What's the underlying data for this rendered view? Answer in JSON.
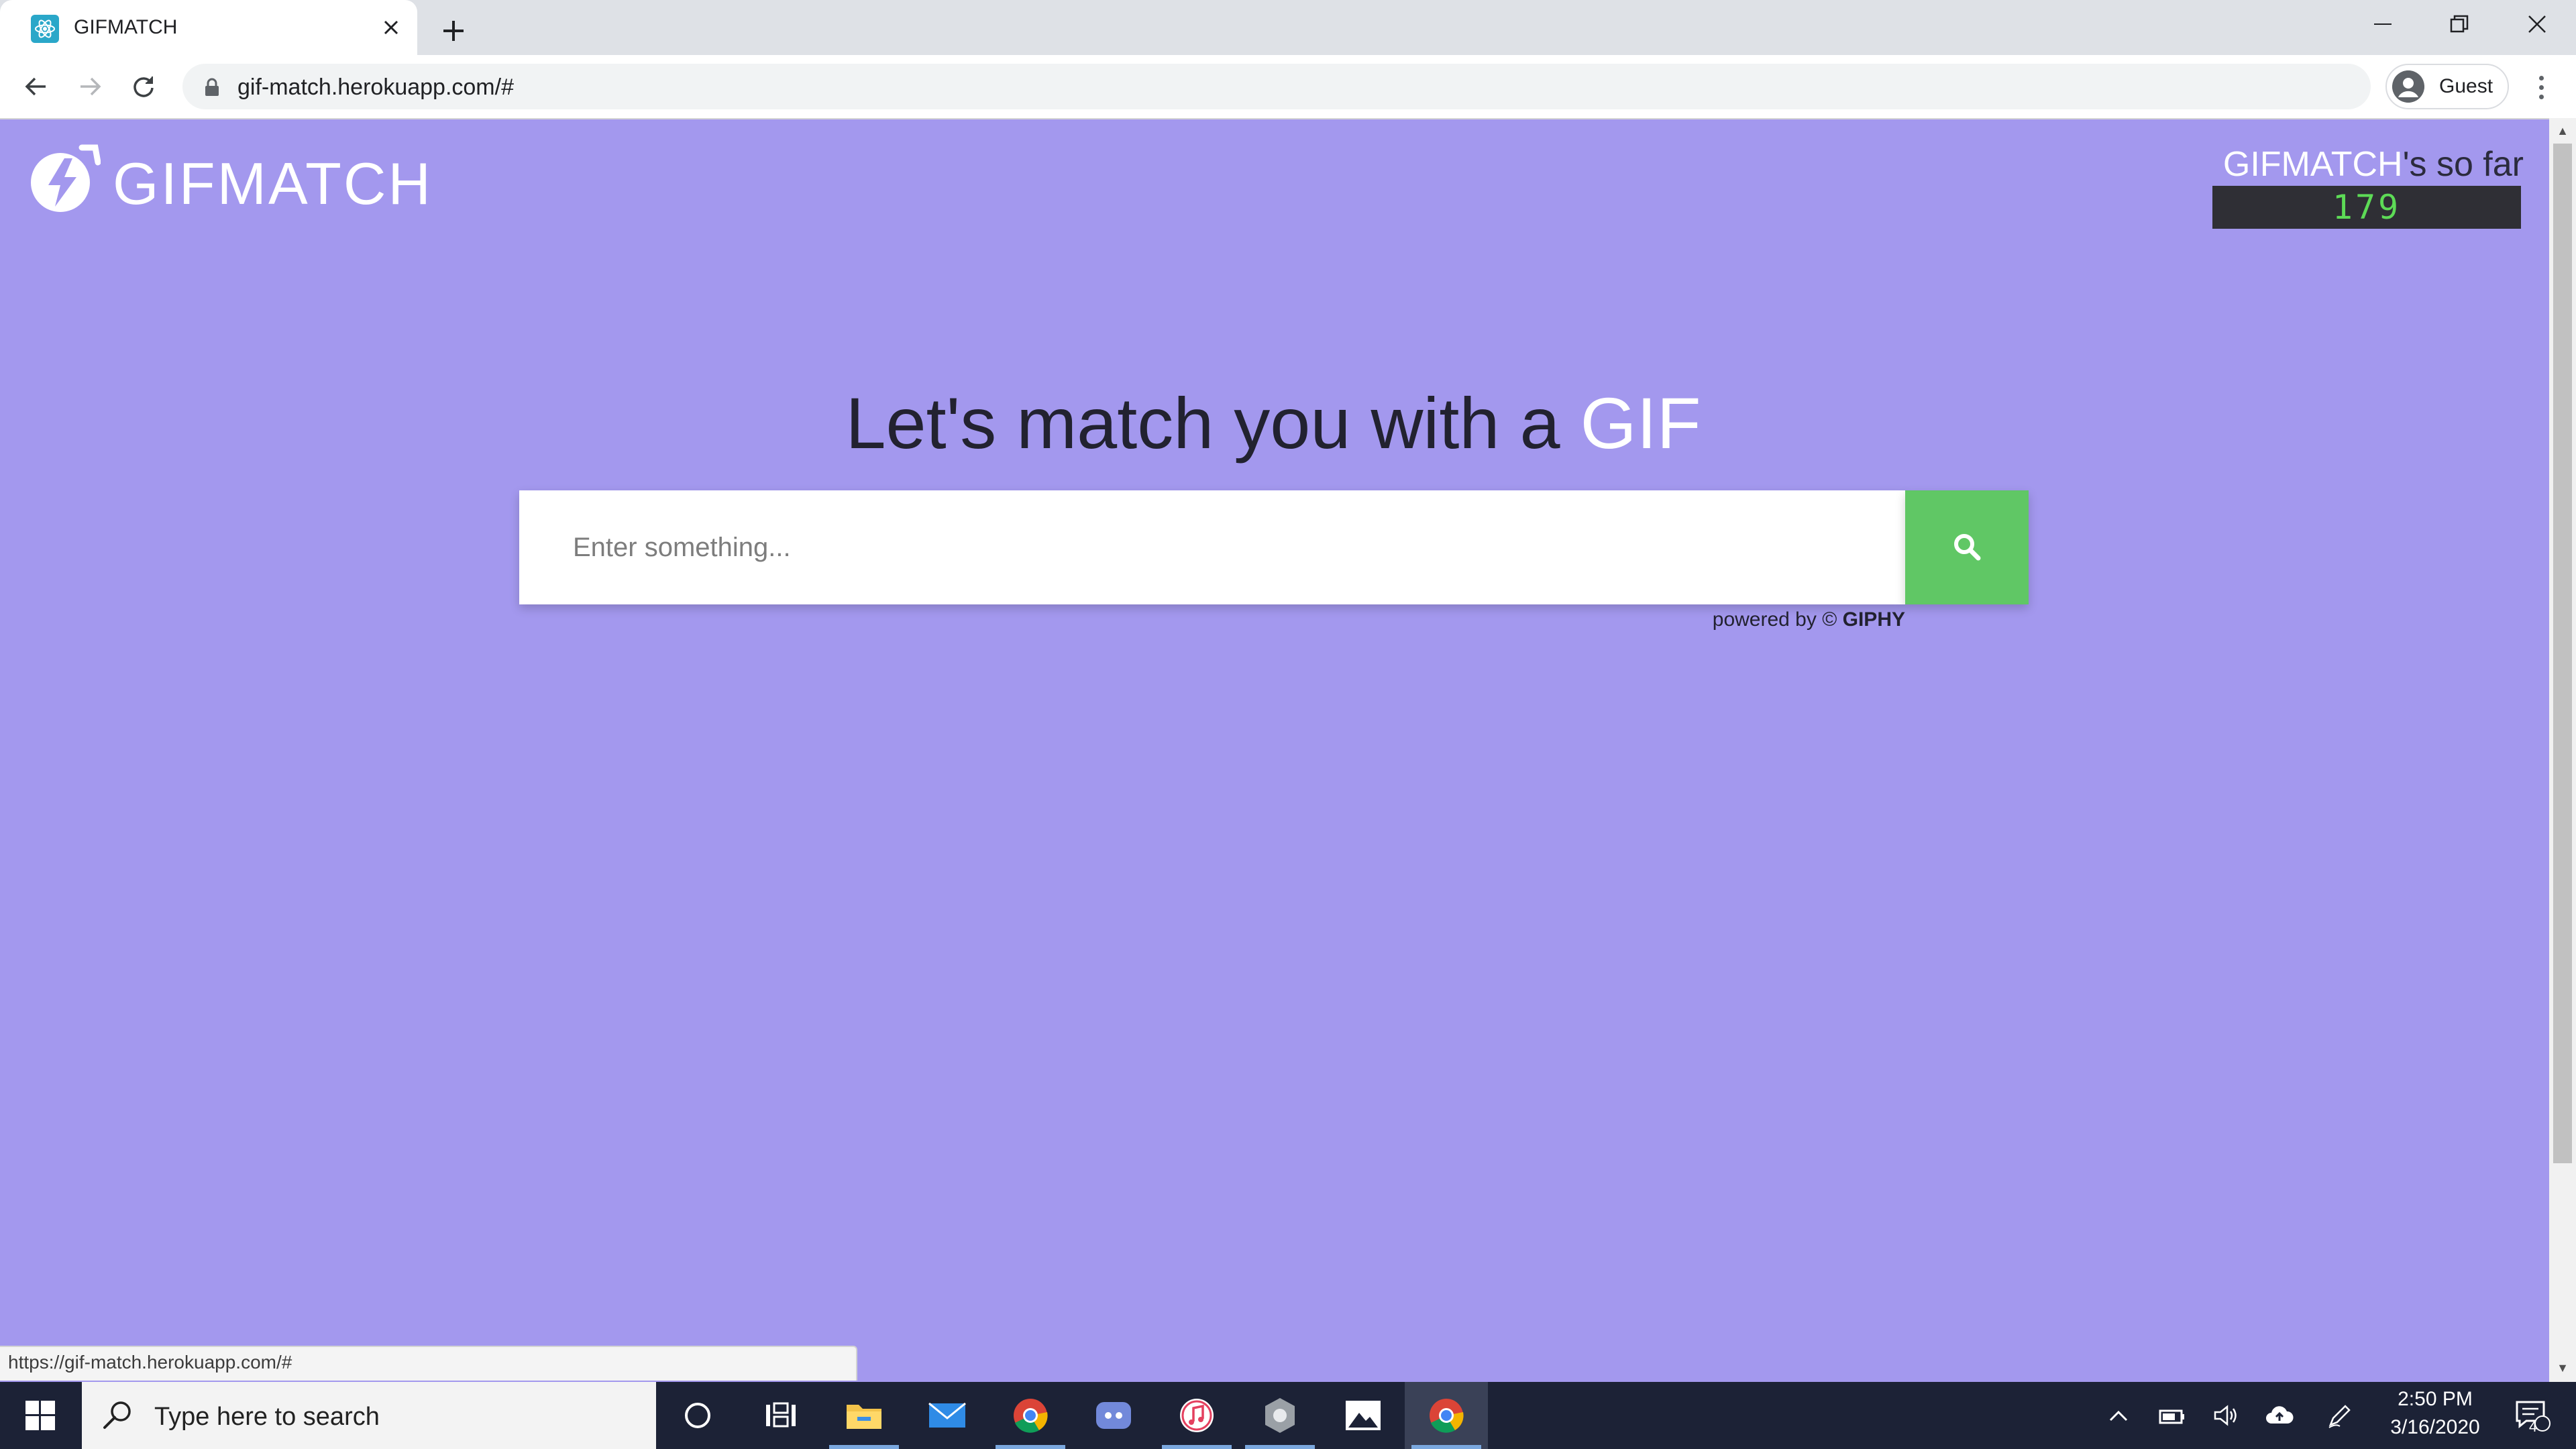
{
  "browser": {
    "tab_title": "GIFMATCH",
    "url": "gif-match.herokuapp.com/#",
    "profile_label": "Guest"
  },
  "page": {
    "logo_text": "GIFMATCH",
    "counter": {
      "label_brand": "GIFMATCH",
      "label_rest": "'s so far",
      "value": "179"
    },
    "headline_prefix": "Let's match you with a ",
    "headline_accent": "GIF",
    "search": {
      "placeholder": "Enter something...",
      "value": ""
    },
    "powered_prefix": "powered by © ",
    "powered_brand": "GIPHY",
    "background_color": "#a398ee",
    "button_color": "#60c765"
  },
  "status_bar": {
    "url": "https://gif-match.herokuapp.com/#"
  },
  "taskbar": {
    "search_placeholder": "Type here to search",
    "apps": [
      "cortana-icon",
      "task-view-icon",
      "file-explorer-icon",
      "mail-icon",
      "chrome-icon",
      "discord-icon",
      "itunes-icon",
      "app-icon",
      "photos-icon",
      "chrome-icon"
    ],
    "clock_time": "2:50 PM",
    "clock_date": "3/16/2020",
    "notification_count": "4"
  }
}
